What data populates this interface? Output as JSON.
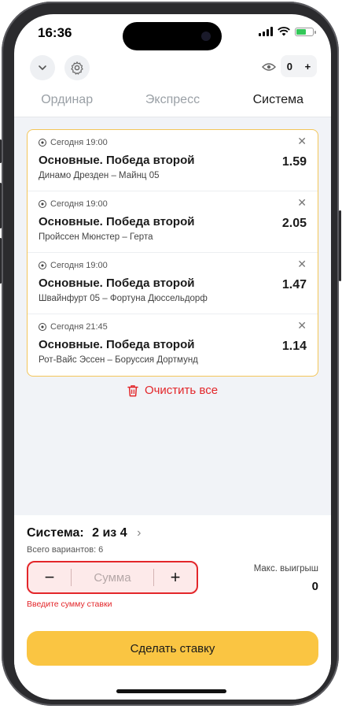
{
  "status": {
    "time": "16:36"
  },
  "header": {
    "counter_value": "0",
    "counter_plus": "+"
  },
  "tabs": [
    {
      "label": "Ординар",
      "active": false
    },
    {
      "label": "Экспресс",
      "active": false
    },
    {
      "label": "Система",
      "active": true
    }
  ],
  "bets": [
    {
      "time": "Сегодня 19:00",
      "market": "Основные. Победа второй",
      "teams": "Динамо Дрезден – Майнц 05",
      "odds": "1.59"
    },
    {
      "time": "Сегодня 19:00",
      "market": "Основные. Победа второй",
      "teams": "Пройссен Мюнстер – Герта",
      "odds": "2.05"
    },
    {
      "time": "Сегодня 19:00",
      "market": "Основные. Победа второй",
      "teams": "Швайнфурт 05 – Фортуна Дюссельдорф",
      "odds": "1.47"
    },
    {
      "time": "Сегодня 21:45",
      "market": "Основные. Победа второй",
      "teams": "Рот-Вайс Эссен – Боруссия Дортмунд",
      "odds": "1.14"
    }
  ],
  "clear_all_label": "Очистить все",
  "system": {
    "label": "Система:",
    "value": "2 из 4",
    "variants": "Всего вариантов: 6"
  },
  "stake": {
    "minus": "−",
    "plus": "+",
    "placeholder": "Сумма",
    "error": "Введите сумму ставки"
  },
  "max_win": {
    "label": "Макс. выигрыш",
    "value": "0"
  },
  "cta_label": "Сделать ставку",
  "colors": {
    "accent": "#fac542",
    "error": "#e3262a",
    "active_tab_underline": "#f6b91a"
  }
}
